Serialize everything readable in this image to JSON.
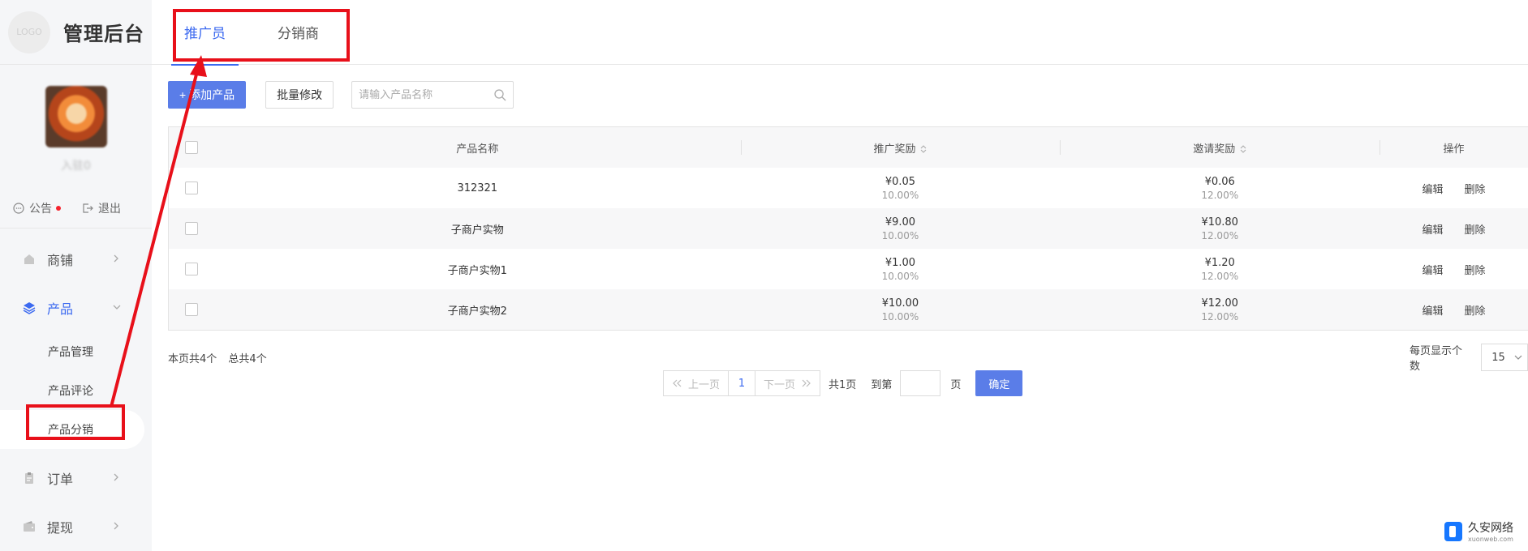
{
  "app": {
    "logo_text": "LOGO",
    "title": "管理后台"
  },
  "profile": {
    "name": "入驻0"
  },
  "quick": {
    "notice": "公告",
    "logout": "退出"
  },
  "menu": {
    "shop": "商铺",
    "product": "产品",
    "product_sub": [
      "产品管理",
      "产品评论",
      "产品分销"
    ],
    "order": "订单",
    "withdraw": "提现"
  },
  "tabs": [
    "推广员",
    "分销商"
  ],
  "toolbar": {
    "add_label": "+ 添加产品",
    "batch_label": "批量修改",
    "search_placeholder": "请输入产品名称"
  },
  "table": {
    "headers": {
      "name": "产品名称",
      "promo": "推广奖励",
      "invite": "邀请奖励",
      "ops": "操作"
    },
    "rows": [
      {
        "name": "312321",
        "promo": "¥0.05",
        "promo_pct": "10.00%",
        "invite": "¥0.06",
        "invite_pct": "12.00%"
      },
      {
        "name": "子商户实物",
        "promo": "¥9.00",
        "promo_pct": "10.00%",
        "invite": "¥10.80",
        "invite_pct": "12.00%"
      },
      {
        "name": "子商户实物1",
        "promo": "¥1.00",
        "promo_pct": "10.00%",
        "invite": "¥1.20",
        "invite_pct": "12.00%"
      },
      {
        "name": "子商户实物2",
        "promo": "¥10.00",
        "promo_pct": "10.00%",
        "invite": "¥12.00",
        "invite_pct": "12.00%"
      }
    ],
    "edit_label": "编辑",
    "delete_label": "删除"
  },
  "footer": {
    "page_count": "本页共4个",
    "total_count": "总共4个",
    "per_page_label": "每页显示个数",
    "per_page_value": "15"
  },
  "pager": {
    "prev": "上一页",
    "current": "1",
    "next": "下一页",
    "total_pages": "共1页",
    "goto": "到第",
    "page_unit": "页",
    "confirm": "确定"
  },
  "watermark": {
    "title": "久安网络",
    "subtitle": "xuonweb.com"
  },
  "colors": {
    "accent": "#3c6af0",
    "button": "#5a7de8",
    "annotation": "#e8101a"
  }
}
